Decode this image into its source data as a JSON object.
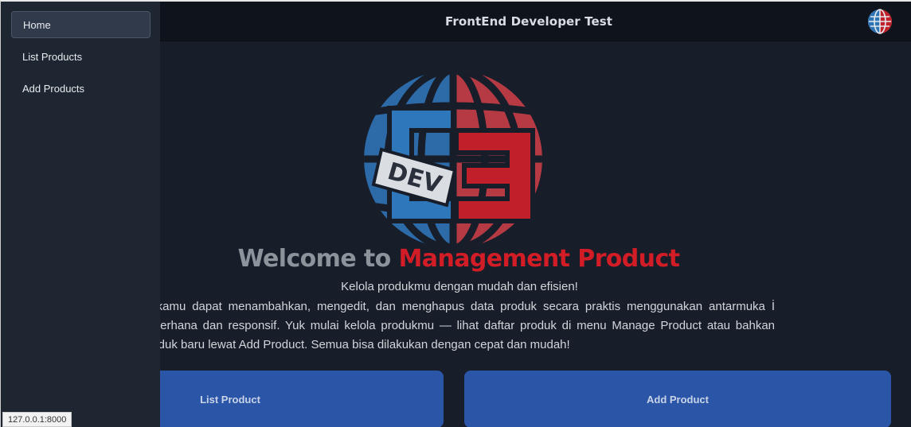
{
  "navbar": {
    "title": "FrontEnd Developer Test",
    "logo_icon": "globe-logo-icon"
  },
  "sidebar": {
    "items": [
      {
        "label": "Home",
        "active": true
      },
      {
        "label": "List Products",
        "active": false
      },
      {
        "label": "Add Products",
        "active": false
      }
    ]
  },
  "hero": {
    "logo_text": "DEV",
    "welcome_prefix": "Welcome to",
    "welcome_highlight": "Management Product",
    "tagline": "Kelola produkmu dengan mudah dan efisien!",
    "description": "ni kamu dapat menambahkan, mengedit, dan menghapus data produk secara praktis menggunakan antarmuka İ sederhana dan responsif. Yuk mulai kelola produkmu — lihat daftar produk di menu Manage Product atau bahkan produk baru lewat Add Product. Semua bisa dilakukan dengan cepat dan mudah!",
    "buttons": {
      "list_label": "List Product",
      "add_label": "Add Product"
    }
  },
  "statusbar": {
    "url": "127.0.0.1:8000"
  },
  "colors": {
    "brand_blue": "#2b55a6",
    "brand_red": "#d21c26",
    "background": "#171e2a",
    "sidebar": "#1e2632"
  }
}
